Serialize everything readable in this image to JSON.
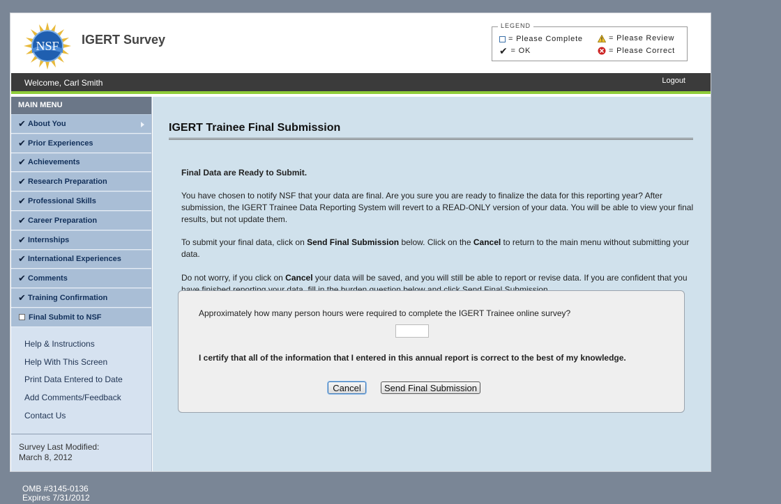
{
  "header": {
    "title": "IGERT Survey",
    "logo_text": "NSF"
  },
  "legend": {
    "title": "LEGEND",
    "items": [
      {
        "icon": "checkbox-empty-icon",
        "label": "= Please Complete"
      },
      {
        "icon": "warning-triangle-icon",
        "label": "= Please Review"
      },
      {
        "icon": "checkmark-icon",
        "label": "= OK"
      },
      {
        "icon": "error-x-icon",
        "label": "= Please Correct"
      }
    ]
  },
  "welcome": {
    "text": "Welcome, Carl Smith",
    "logout_label": "Logout"
  },
  "sidebar": {
    "menu_header": "MAIN MENU",
    "items": [
      {
        "label": "About You",
        "status": "ok"
      },
      {
        "label": "Prior Experiences",
        "status": "ok"
      },
      {
        "label": "Achievements",
        "status": "ok"
      },
      {
        "label": "Research Preparation",
        "status": "ok"
      },
      {
        "label": "Professional Skills",
        "status": "ok"
      },
      {
        "label": "Career Preparation",
        "status": "ok"
      },
      {
        "label": "Internships",
        "status": "ok"
      },
      {
        "label": "International Experiences",
        "status": "ok"
      },
      {
        "label": "Comments",
        "status": "ok"
      },
      {
        "label": "Training Confirmation",
        "status": "ok"
      },
      {
        "label": "Final Submit to NSF",
        "status": "complete"
      }
    ],
    "help_links": [
      "Help & Instructions",
      "Help With This Screen",
      "Print Data Entered to Date",
      "Add Comments/Feedback",
      "Contact Us"
    ],
    "survey_modified_label": "Survey Last Modified:",
    "survey_modified_date": "March 8, 2012"
  },
  "content": {
    "title": "IGERT Trainee Final Submission",
    "ready_heading": "Final Data are Ready to Submit.",
    "para1": "You have chosen to notify NSF that your data are final. Are you sure you are ready to finalize the data for this reporting year? After submission, the IGERT Trainee Data Reporting System will revert to a READ-ONLY version of your data. You will be able to view your final results, but not update them.",
    "para2_a": "To submit your final data, click on ",
    "para2_b": "Send Final Submission",
    "para2_c": " below. Click on the ",
    "para2_d": "Cancel",
    "para2_e": " to return to the main menu without submitting your data.",
    "para3_a": "Do not worry, if you click on ",
    "para3_b": "Cancel",
    "para3_c": " your data will be saved, and you will still be able to report or revise data. If you are confident that you have finished reporting your data, fill in the burden question below and click Send Final Submission.",
    "form": {
      "hours_question": "Approximately how many person hours were required to complete the IGERT Trainee online survey?",
      "hours_value": "",
      "certify_text": "I certify that all of the information that I entered in this annual report is correct to the best of my knowledge.",
      "cancel_label": "Cancel",
      "submit_label": "Send Final Submission"
    }
  },
  "footer": {
    "omb": "OMB #3145-0136",
    "expires": "Expires 7/31/2012"
  },
  "colors": {
    "page_bg": "#7a8696",
    "welcome_bar": "#3b3b3b",
    "accent_green": "#8fcc3a",
    "menu_item_bg": "#a9bed6",
    "content_bg": "#d0e1ec"
  }
}
